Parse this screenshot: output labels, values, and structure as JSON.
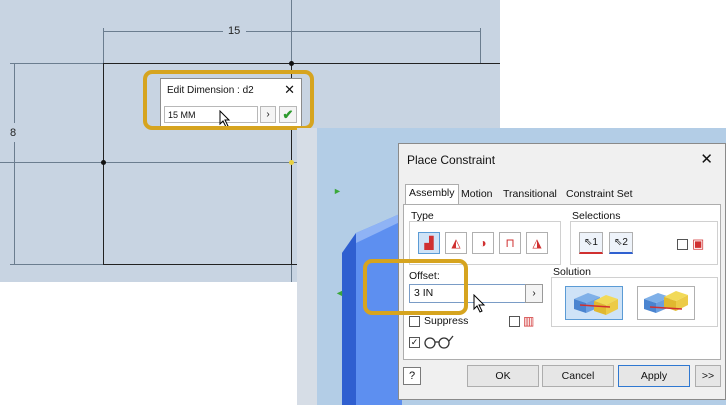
{
  "sketch": {
    "dim_horizontal": "15",
    "dim_vertical": "8"
  },
  "edit_dimension": {
    "title": "Edit Dimension : d2",
    "value": "15 MM",
    "close": "✕",
    "arrow": "›",
    "ok": "✔"
  },
  "place_constraint": {
    "title": "Place Constraint",
    "close": "✕",
    "tabs": [
      "Assembly",
      "Motion",
      "Transitional",
      "Constraint Set"
    ],
    "type_label": "Type",
    "selections_label": "Selections",
    "selection_1": "1",
    "selection_2": "2",
    "offset_label": "Offset:",
    "offset_value": "3 IN",
    "offset_arrow": "›",
    "solution_label": "Solution",
    "suppress_label": "Suppress",
    "buttons": {
      "ok": "OK",
      "cancel": "Cancel",
      "apply": "Apply",
      "more": ">>"
    },
    "help": "?"
  },
  "colors": {
    "highlight": "#d6a41f",
    "sketch_background": "#c8d4e2",
    "assembly_background": "#b3cde6",
    "accent": "#2f78d1"
  }
}
